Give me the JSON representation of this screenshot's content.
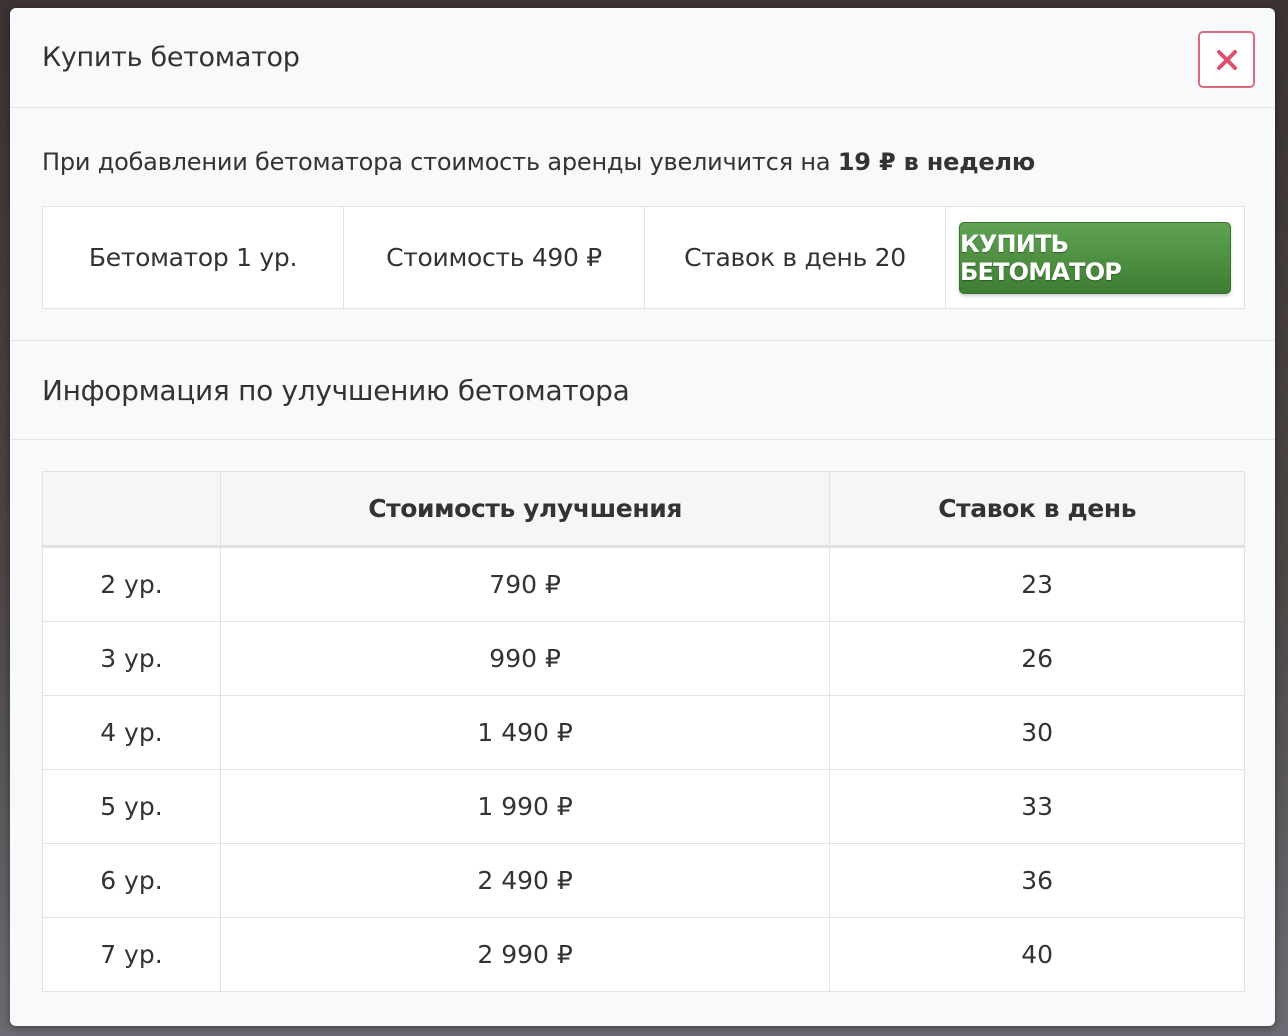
{
  "modal": {
    "title": "Купить бетоматор",
    "close_icon": "close-icon"
  },
  "notice": {
    "prefix": "При добавлении бетоматора стоимость аренды увеличится на",
    "amount": "19 ₽ в неделю"
  },
  "buy": {
    "level": "Бетоматор 1 ур.",
    "cost": "Стоимость 490 ₽",
    "bets": "Ставок в день 20",
    "button_label": "Купить бетоматор"
  },
  "info": {
    "title": "Информация по улучшению бетоматора"
  },
  "table": {
    "headers": [
      "",
      "Стоимость улучшения",
      "Ставок в день"
    ],
    "rows": [
      [
        "2 ур.",
        "790 ₽",
        "23"
      ],
      [
        "3 ур.",
        "990 ₽",
        "26"
      ],
      [
        "4 ур.",
        "1 490 ₽",
        "30"
      ],
      [
        "5 ур.",
        "1 990 ₽",
        "33"
      ],
      [
        "6 ур.",
        "2 490 ₽",
        "36"
      ],
      [
        "7 ур.",
        "2 990 ₽",
        "40"
      ]
    ]
  },
  "colors": {
    "close_accent": "#dd6a80",
    "buy_button": "#4f9444"
  }
}
